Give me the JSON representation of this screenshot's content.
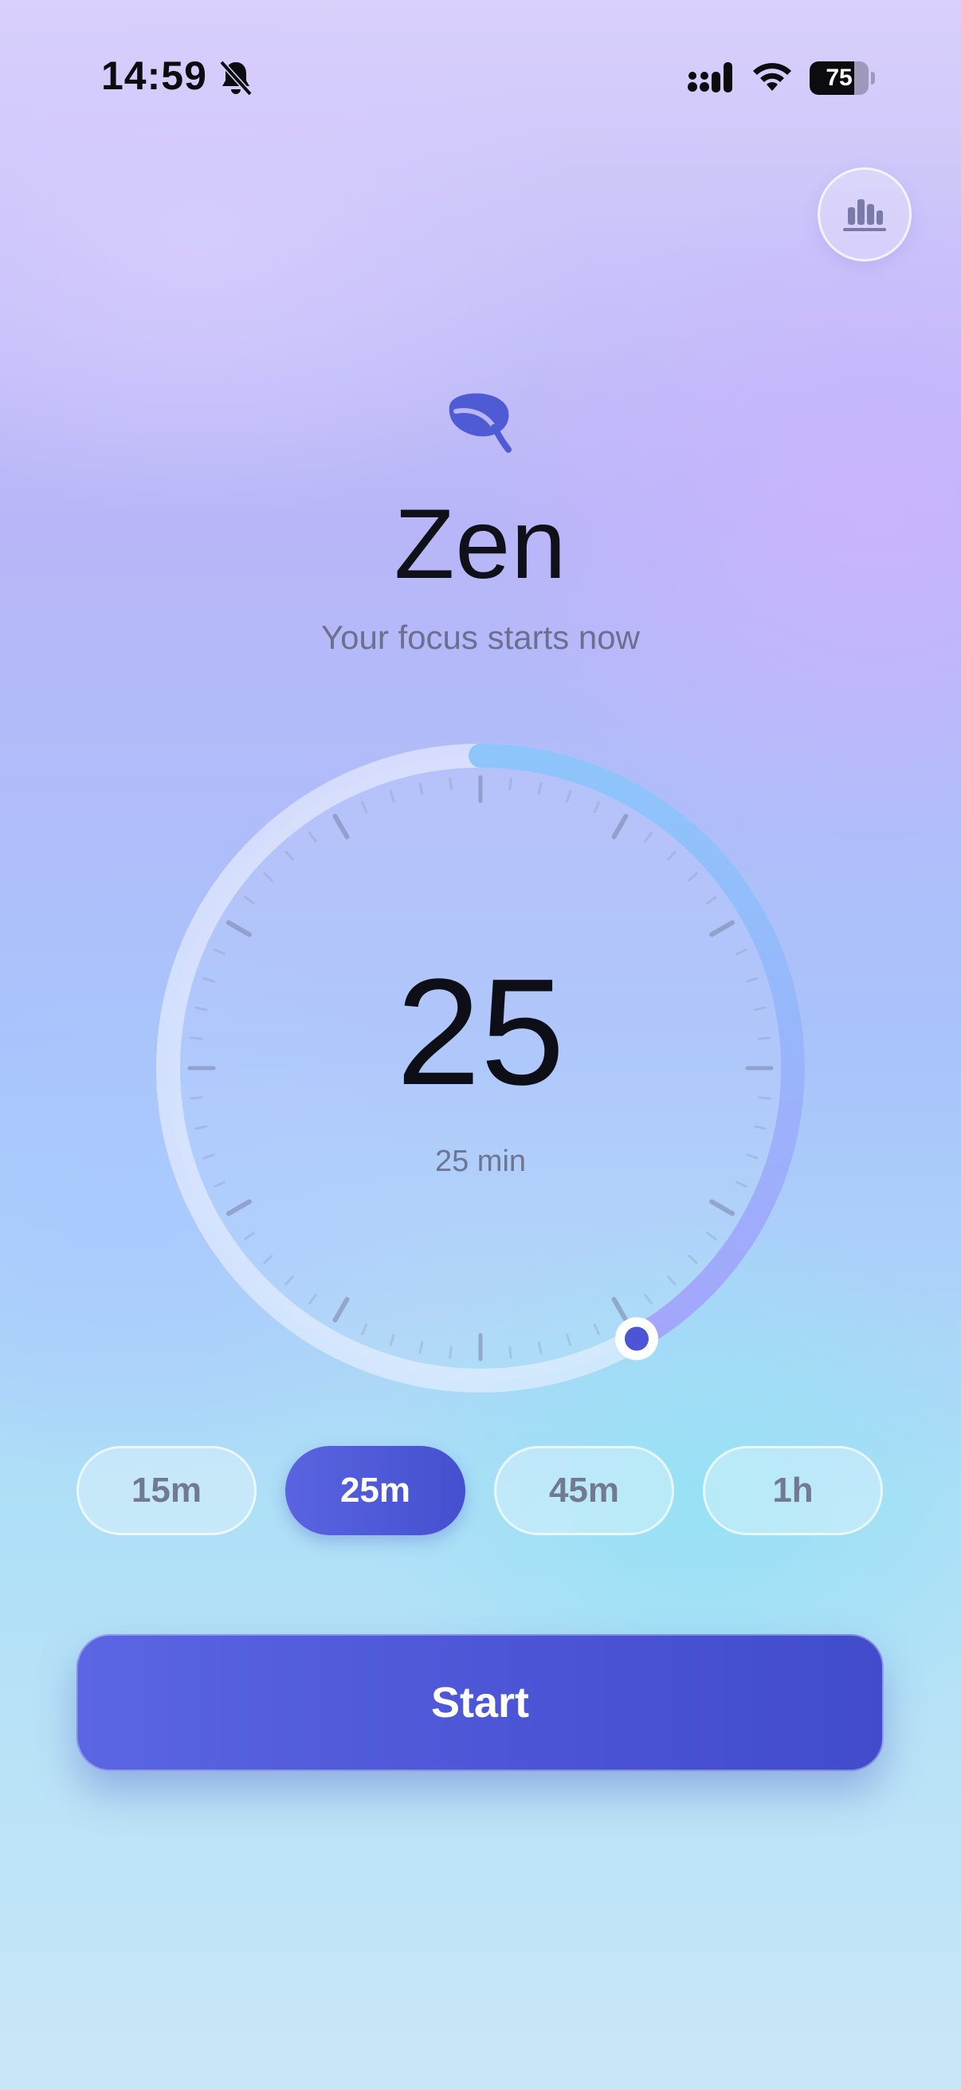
{
  "status_bar": {
    "time": "14:59",
    "battery_level": "75",
    "battery_fraction": 0.75
  },
  "header": {
    "icon": "leaf-icon",
    "title": "Zen",
    "subtitle": "Your focus starts now"
  },
  "timer": {
    "value": "25",
    "unit_label": "25 min",
    "selected_minutes": 25,
    "max_minutes": 60
  },
  "presets": [
    {
      "label": "15m",
      "active": false
    },
    {
      "label": "25m",
      "active": true
    },
    {
      "label": "45m",
      "active": false
    },
    {
      "label": "1h",
      "active": false
    }
  ],
  "actions": {
    "start_label": "Start"
  },
  "icons": {
    "top_right": "bar-chart-icon"
  },
  "colors": {
    "accent": "#4b55d5",
    "progress_start": "#8ec5fb",
    "progress_end": "#a3a6fb"
  }
}
